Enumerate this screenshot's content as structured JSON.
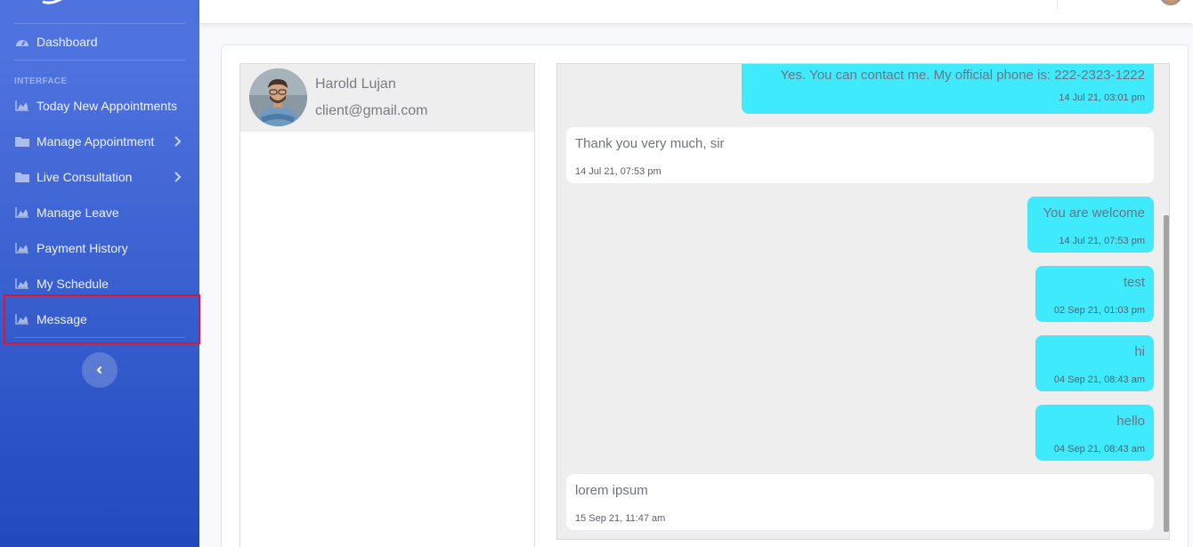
{
  "sidebar": {
    "heading": "INTERFACE",
    "items": [
      {
        "label": "Dashboard",
        "icon": "dashboard-icon"
      },
      {
        "label": "Today New Appointments",
        "icon": "chart-area-icon"
      },
      {
        "label": "Manage Appointment",
        "icon": "folder-icon"
      },
      {
        "label": "Live Consultation",
        "icon": "folder-icon"
      },
      {
        "label": "Manage Leave",
        "icon": "chart-area-icon"
      },
      {
        "label": "Payment History",
        "icon": "chart-area-icon"
      },
      {
        "label": "My Schedule",
        "icon": "chart-area-icon"
      },
      {
        "label": "Message",
        "icon": "chart-area-icon"
      }
    ],
    "toggle_icon": "chevron-left-icon"
  },
  "contact": {
    "name": "Harold Lujan",
    "email": "client@gmail.com"
  },
  "messages": [
    {
      "direction": "out",
      "text": "Yes. You can contact me. My official phone is: 222-2323-1222",
      "time": "14 Jul 21, 03:01 pm"
    },
    {
      "direction": "in",
      "text": "Thank you very much, sir",
      "time": "14 Jul 21, 07:53 pm"
    },
    {
      "direction": "out",
      "text": "You are welcome",
      "time": "14 Jul 21, 07:53 pm"
    },
    {
      "direction": "out",
      "text": "test",
      "time": "02 Sep 21, 01:03 pm"
    },
    {
      "direction": "out",
      "text": "hi",
      "time": "04 Sep 21, 08:43 am"
    },
    {
      "direction": "out",
      "text": "hello",
      "time": "04 Sep 21, 08:43 am"
    },
    {
      "direction": "in",
      "text": "lorem ipsum",
      "time": "15 Sep 21, 11:47 am"
    }
  ],
  "colors": {
    "sidebar_top": "#4e73df",
    "sidebar_bottom": "#224abe",
    "outgoing_bubble": "#3eeafc",
    "incoming_bubble": "#ffffff",
    "highlight": "#e0142a"
  }
}
